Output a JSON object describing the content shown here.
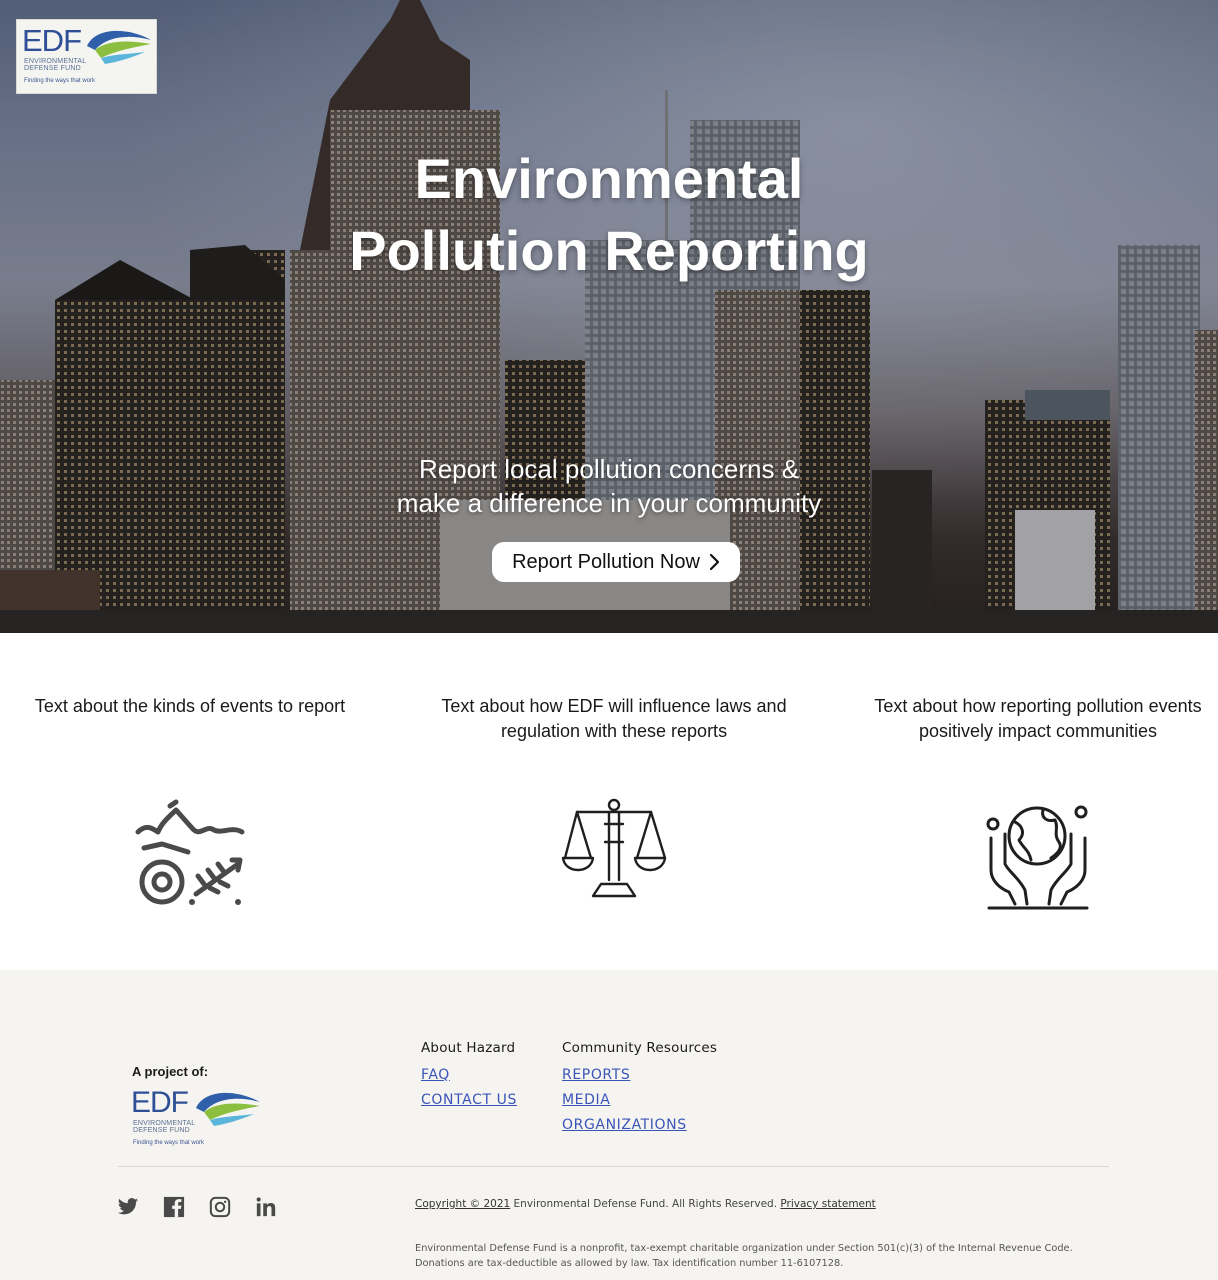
{
  "logo": {
    "text": "EDF",
    "line1": "ENVIRONMENTAL",
    "line2": "DEFENSE FUND",
    "tagline": "Finding the ways that work"
  },
  "hero": {
    "title_line1": "Environmental",
    "title_line2": "Pollution Reporting",
    "subtitle_line1": "Report local pollution concerns &",
    "subtitle_line2": "make a difference in your community",
    "cta_label": "Report Pollution Now",
    "cta_icon": "chevron-right-icon"
  },
  "features": [
    {
      "text": "Text about the kinds of events to report",
      "icon": "polluted-water-icon"
    },
    {
      "text": "Text about how EDF will influence laws and regulation with these reports",
      "icon": "scales-of-justice-icon"
    },
    {
      "text": "Text about how reporting pollution events positively impact communities",
      "icon": "hands-holding-globe-icon"
    }
  ],
  "footer": {
    "project_label": "A project of:",
    "columns": [
      {
        "heading": "About Hazard",
        "links": [
          "FAQ",
          "CONTACT US"
        ]
      },
      {
        "heading": "Community Resources",
        "links": [
          "REPORTS",
          "MEDIA",
          "ORGANIZATIONS"
        ]
      }
    ],
    "social": [
      "twitter-icon",
      "facebook-icon",
      "instagram-icon",
      "linkedin-icon"
    ],
    "copyright": "Copyright © 2021",
    "copyright_rest": " Environmental Defense Fund. All Rights Reserved. ",
    "privacy": "Privacy statement",
    "legal_line1": "Environmental Defense Fund is a nonprofit, tax-exempt charitable organization under Section 501(c)(3) of the Internal Revenue Code.",
    "legal_line2": "Donations are tax-deductible as allowed by law. Tax identification number 11-6107128."
  },
  "colors": {
    "link": "#3a55b8",
    "footer_bg": "#f5f4f1",
    "brand_blue": "#2e4f96"
  }
}
